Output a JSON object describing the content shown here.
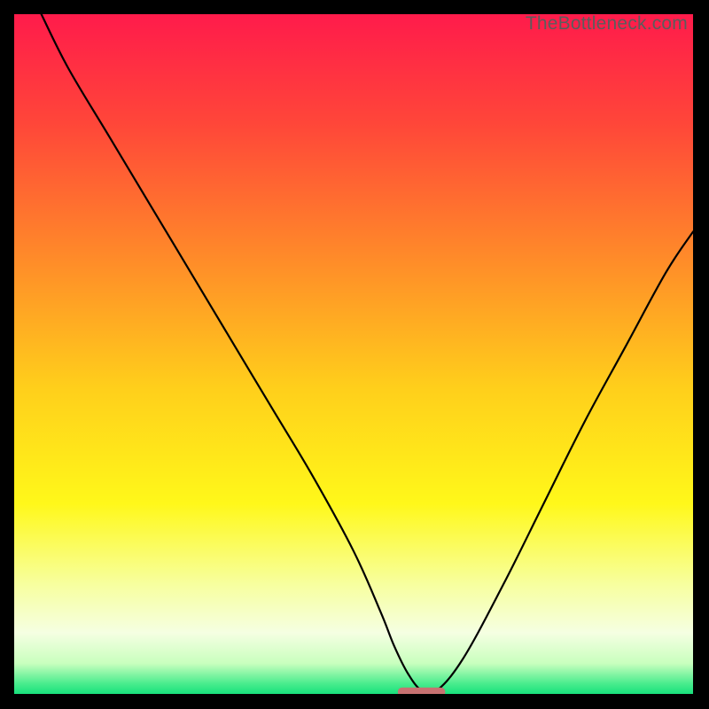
{
  "watermark": "TheBottleneck.com",
  "chart_data": {
    "type": "line",
    "title": "",
    "xlabel": "",
    "ylabel": "",
    "xlim": [
      0,
      100
    ],
    "ylim": [
      0,
      100
    ],
    "grid": false,
    "legend": false,
    "series": [
      {
        "name": "bottleneck-curve",
        "x": [
          4,
          8,
          14,
          20,
          26,
          32,
          38,
          44,
          50,
          54,
          56,
          58,
          60,
          62,
          66,
          72,
          78,
          84,
          90,
          96,
          100
        ],
        "y": [
          100,
          92,
          82,
          72,
          62,
          52,
          42,
          32,
          21,
          12,
          7,
          3,
          0.5,
          0.3,
          5,
          16,
          28,
          40,
          51,
          62,
          68
        ]
      }
    ],
    "minimum_marker": {
      "x_start": 56.5,
      "x_end": 63.5,
      "y": 0.3,
      "color": "#c77171"
    },
    "background": {
      "type": "vertical-gradient",
      "stops": [
        {
          "offset": 0.0,
          "color": "#ff1b4b"
        },
        {
          "offset": 0.16,
          "color": "#ff4639"
        },
        {
          "offset": 0.36,
          "color": "#ff8b29"
        },
        {
          "offset": 0.55,
          "color": "#ffcf1b"
        },
        {
          "offset": 0.72,
          "color": "#fff81a"
        },
        {
          "offset": 0.84,
          "color": "#f7ffa0"
        },
        {
          "offset": 0.91,
          "color": "#f5ffe2"
        },
        {
          "offset": 0.955,
          "color": "#c9ffbe"
        },
        {
          "offset": 0.985,
          "color": "#49ec8d"
        },
        {
          "offset": 1.0,
          "color": "#17e07c"
        }
      ]
    }
  }
}
